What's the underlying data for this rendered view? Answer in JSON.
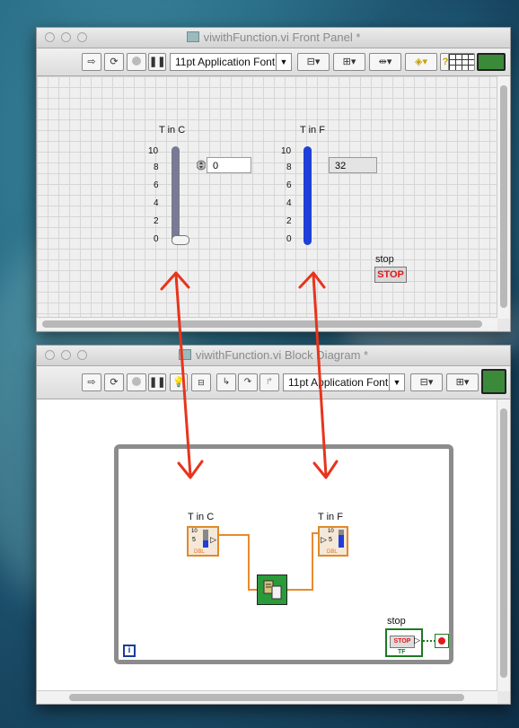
{
  "front_panel": {
    "title": "viwithFunction.vi Front Panel *",
    "font_ring": "11pt Application Font",
    "controls": {
      "t_in_c": {
        "label": "T in C",
        "scale": [
          "10",
          "8",
          "6",
          "4",
          "2",
          "0"
        ],
        "value": "0",
        "fill_fraction": 0.0
      },
      "t_in_f": {
        "label": "T in F",
        "scale": [
          "10",
          "8",
          "6",
          "4",
          "2",
          "0"
        ],
        "value": "32",
        "fill_fraction": 1.0
      },
      "stop": {
        "label": "stop",
        "button": "STOP"
      }
    }
  },
  "block_diagram": {
    "title": "viwithFunction.vi Block Diagram *",
    "font_ring": "11pt Application Font",
    "terminals": {
      "t_in_c": {
        "label": "T in C",
        "scale_top": "10",
        "scale_mid": "5",
        "type": "DBL"
      },
      "t_in_f": {
        "label": "T in F",
        "scale_top": "10",
        "scale_mid": "5",
        "type": "DBL"
      },
      "stop": {
        "label": "stop",
        "button": "STOP",
        "type": "TF"
      }
    },
    "iteration_label": "i"
  },
  "colors": {
    "arrow": "#e8341c",
    "wire": "#e88a2e",
    "thermo_c": "#7a7a94",
    "thermo_f": "#1f3fd8"
  },
  "icons": [
    "run-arrow-icon",
    "run-continuous-icon",
    "abort-icon",
    "pause-icon",
    "highlight-execution-icon",
    "retain-wire-values-icon",
    "step-into-icon",
    "step-over-icon",
    "step-out-icon",
    "align-icon",
    "distribute-icon",
    "resize-icon",
    "reorder-icon",
    "help-icon",
    "connector-pane-icon",
    "vi-icon"
  ]
}
